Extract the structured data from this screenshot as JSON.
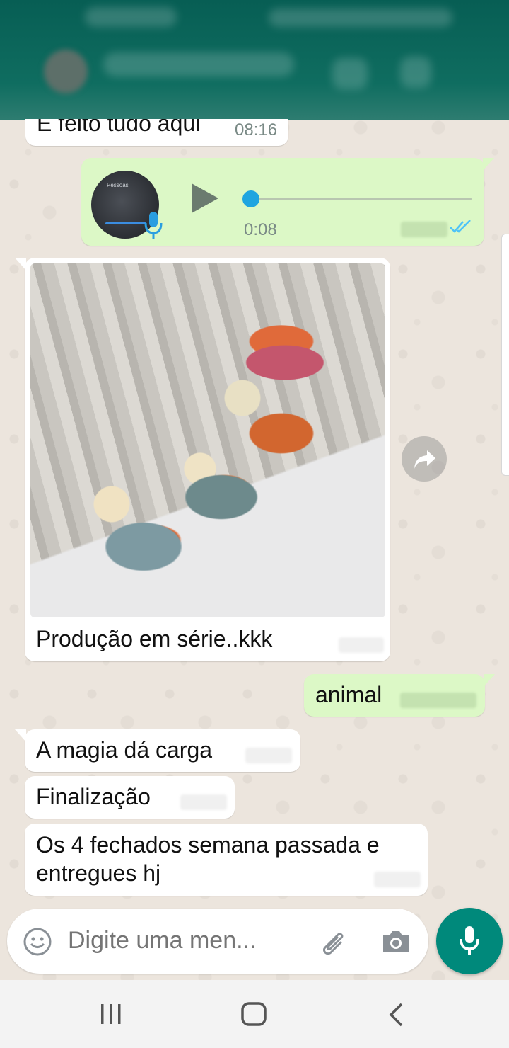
{
  "header": {
    "contact_name": "",
    "status": ""
  },
  "messages": {
    "m1": {
      "text": "É feito tudo aqui",
      "time": "08:16"
    },
    "voice": {
      "duration": "0:08",
      "progress": 0.0,
      "avatar_text": "Pessoas"
    },
    "image": {
      "caption": "Produção em série..kkk"
    },
    "m3": {
      "text": "animal"
    },
    "m4": {
      "text": "A magia dá carga"
    },
    "m5": {
      "text": "Finalização"
    },
    "m6": {
      "line1": "Os 4 fechados semana passada e",
      "line2": "entregues hj"
    }
  },
  "composer": {
    "placeholder": "Digite uma men...",
    "emoji_icon": "smiley-icon",
    "attach_icon": "paperclip-icon",
    "camera_icon": "camera-icon",
    "mic_icon": "microphone-icon"
  },
  "colors": {
    "header": "#075e54",
    "outgoing_bubble": "#dcf8c6",
    "incoming_bubble": "#ffffff",
    "chat_background": "#ece5dd",
    "read_ticks": "#4fc3f7",
    "fab": "#00897b"
  },
  "navbar": {
    "recents_icon": "recents-icon",
    "home_icon": "home-icon",
    "back_icon": "back-icon"
  }
}
